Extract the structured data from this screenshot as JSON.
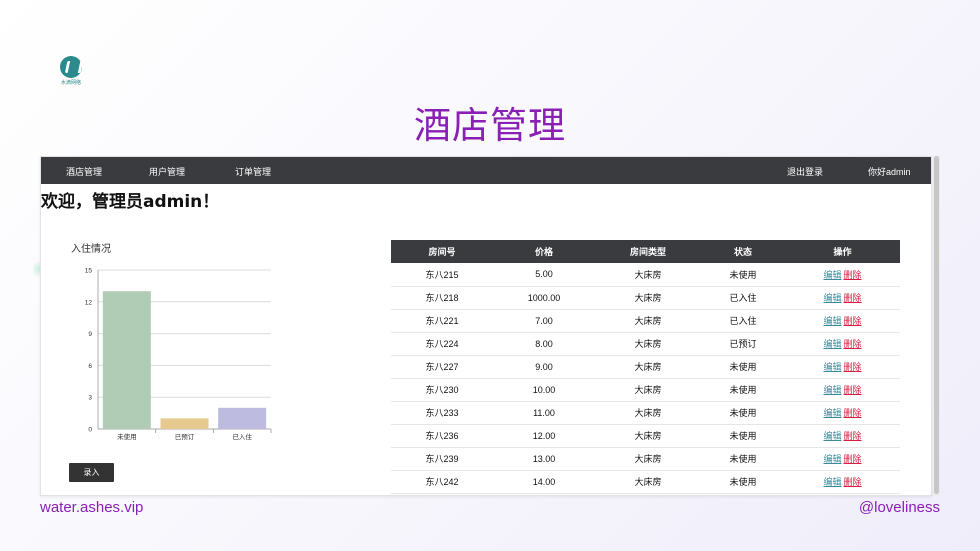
{
  "slide": {
    "logo_text": "水滴网络",
    "title": "酒店管理",
    "footer_left": "water.ashes.vip",
    "footer_right": "@loveliness"
  },
  "nav": {
    "items": [
      "酒店管理",
      "用户管理",
      "订单管理"
    ],
    "logout": "退出登录",
    "greeting": "你好admin"
  },
  "welcome": "欢迎，管理员admin！",
  "chart_data": {
    "type": "bar",
    "title": "入住情况",
    "categories": [
      "未使用",
      "已预订",
      "已入住"
    ],
    "values": [
      13,
      1,
      2
    ],
    "colors": [
      "#b0ccb5",
      "#e5c98e",
      "#bdbbe0"
    ],
    "yticks": [
      0,
      3,
      6,
      9,
      12,
      15
    ],
    "ylim": [
      0,
      15
    ],
    "grid": true
  },
  "add_button": "录入",
  "table": {
    "headers": [
      "房间号",
      "价格",
      "房间类型",
      "状态",
      "操作"
    ],
    "edit_label": "编辑",
    "delete_label": "删除",
    "rows": [
      [
        "东八215",
        "5.00",
        "大床房",
        "未使用"
      ],
      [
        "东八218",
        "1000.00",
        "大床房",
        "已入住"
      ],
      [
        "东八221",
        "7.00",
        "大床房",
        "已入住"
      ],
      [
        "东八224",
        "8.00",
        "大床房",
        "已预订"
      ],
      [
        "东八227",
        "9.00",
        "大床房",
        "未使用"
      ],
      [
        "东八230",
        "10.00",
        "大床房",
        "未使用"
      ],
      [
        "东八233",
        "11.00",
        "大床房",
        "未使用"
      ],
      [
        "东八236",
        "12.00",
        "大床房",
        "未使用"
      ],
      [
        "东八239",
        "13.00",
        "大床房",
        "未使用"
      ],
      [
        "东八242",
        "14.00",
        "大床房",
        "未使用"
      ]
    ]
  }
}
